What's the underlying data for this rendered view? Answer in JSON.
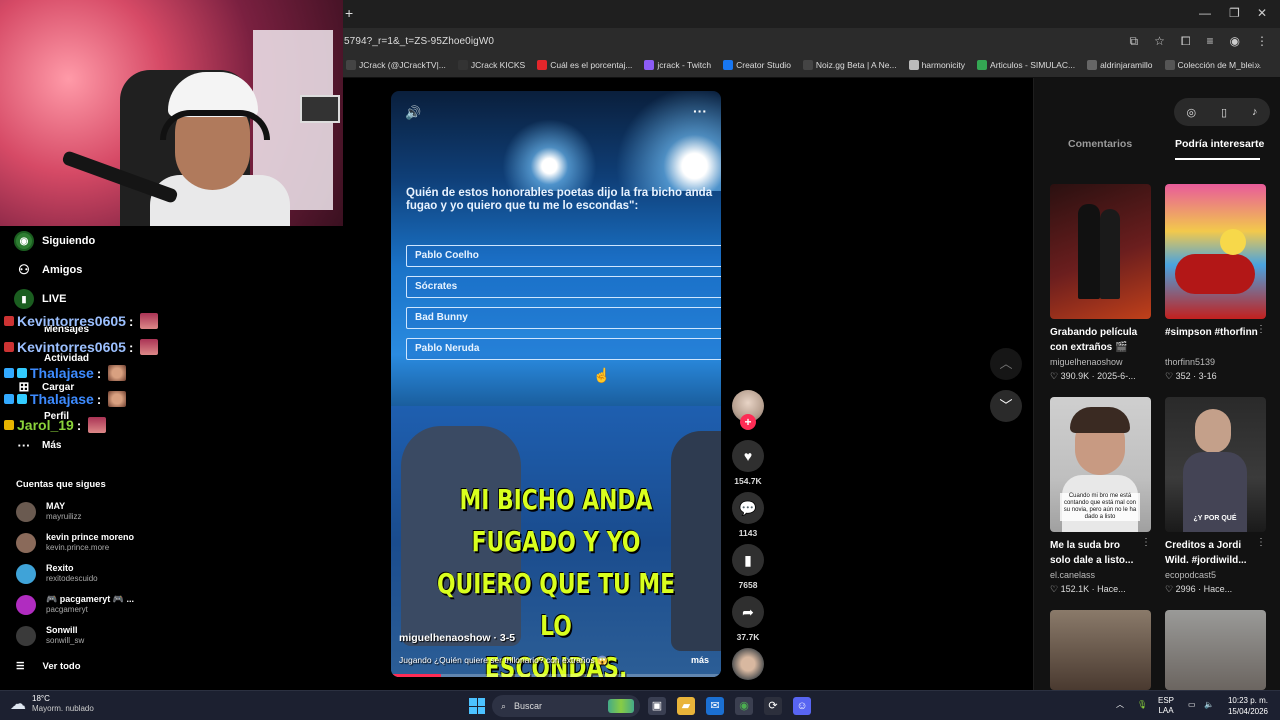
{
  "browser": {
    "url": "5794?_r=1&_t=ZS-95Zhoe0igW0",
    "new_tab": "+",
    "bookmarks": [
      {
        "label": "JCrack (@JCrackTV|...",
        "color": "#444"
      },
      {
        "label": "JCrack KICKS",
        "color": "#333"
      },
      {
        "label": "Cuál es el porcentaj...",
        "color": "#e3262b"
      },
      {
        "label": "jcrack - Twitch",
        "color": "#8c5cf6"
      },
      {
        "label": "Creator Studio",
        "color": "#1877f2"
      },
      {
        "label": "Noiz.gg Beta | A Ne...",
        "color": "#444"
      },
      {
        "label": "harmonicity",
        "color": "#bbb"
      },
      {
        "label": "Articulos - SIMULAC...",
        "color": "#34a853"
      },
      {
        "label": "aldrinjaramillo",
        "color": "#666"
      },
      {
        "label": "Colección de M_blei...",
        "color": "#555"
      }
    ],
    "bookmarks_more": "»"
  },
  "nav": {
    "siguiendo": "Siguiendo",
    "amigos": "Amigos",
    "live": "LIVE",
    "mensajes": "Mensajes",
    "actividad": "Actividad",
    "cargar": "Cargar",
    "perfil": "Perfil",
    "mas": "Más"
  },
  "chat": [
    {
      "name": "Kevintorres0605",
      "colon": ":"
    },
    {
      "name": "Kevintorres0605",
      "colon": ":"
    },
    {
      "name": "Thalajase",
      "colon": ":"
    },
    {
      "name": "Thalajase",
      "colon": ":"
    },
    {
      "name": "Jarol_19",
      "colon": ":"
    }
  ],
  "following": {
    "title": "Cuentas que sigues",
    "accounts": [
      {
        "name": "MAY",
        "handle": "mayruilizz",
        "color": "#6a5a50"
      },
      {
        "name": "kevin prince moreno",
        "handle": "kevin.prince.more",
        "color": "#8a6a5a"
      },
      {
        "name": "Rexito",
        "handle": "rexitodescuido",
        "color": "#3fa3d8"
      },
      {
        "name": "🎮 pacgameryt 🎮 ...",
        "handle": "pacgameryt",
        "color": "#b02cc0"
      },
      {
        "name": "Sonwill",
        "handle": "sonwill_sw",
        "color": "#3a3a3a"
      }
    ],
    "see_all": "Ver todo"
  },
  "video": {
    "question": "Quién de estos honorables poetas dijo la fra bicho anda fugao y yo quiero que tu me lo escondas\":",
    "options": [
      "Pablo Coelho",
      "Sócrates",
      "Bad Bunny",
      "Pablo Neruda"
    ],
    "subtitle_1": "MI BICHO ANDA FUGADO Y YO",
    "subtitle_2": "QUIERO QUE TU ME LO",
    "subtitle_3": "ESCONDAS.",
    "author": "miguelhenaoshow · 3-5",
    "description": "Jugando ¿Quién quiere ser trillonario? con extraños 😱",
    "more": "más",
    "progress": 0.15
  },
  "actions": {
    "likes": "154.7K",
    "comments": "1143",
    "saves": "7658",
    "shares": "37.7K"
  },
  "panel": {
    "tab_comments": "Comentarios",
    "tab_interest": "Podría interesarte",
    "cards": [
      {
        "title": "Grabando película con extraños 🎬",
        "author": "miguelhenaoshow",
        "meta": "♡ 390.9K · 2025-6-...",
        "caption": ""
      },
      {
        "title": "#simpson #thorfinn",
        "author": "thorfinn5139",
        "meta": "♡ 352 · 3-16",
        "caption": ""
      },
      {
        "title": "Me la suda bro solo dale a listo...",
        "author": "el.canelass",
        "meta": "♡ 152.1K · Hace...",
        "caption": "Cuando mi bro me está contando que está mal con su novia, pero aún no le ha dado a listo"
      },
      {
        "title": "Creditos a Jordi Wild. #jordiwild...",
        "author": "ecopodcast5",
        "meta": "♡ 2996 · Hace...",
        "caption": "¿Y POR QUÉ"
      }
    ]
  },
  "taskbar": {
    "temp": "18°C",
    "weather": "Mayorm. nublado",
    "search": "Buscar",
    "lang_1": "ESP",
    "lang_2": "LAA",
    "time": "10:23 p. m.",
    "date": "15/04/2026"
  }
}
